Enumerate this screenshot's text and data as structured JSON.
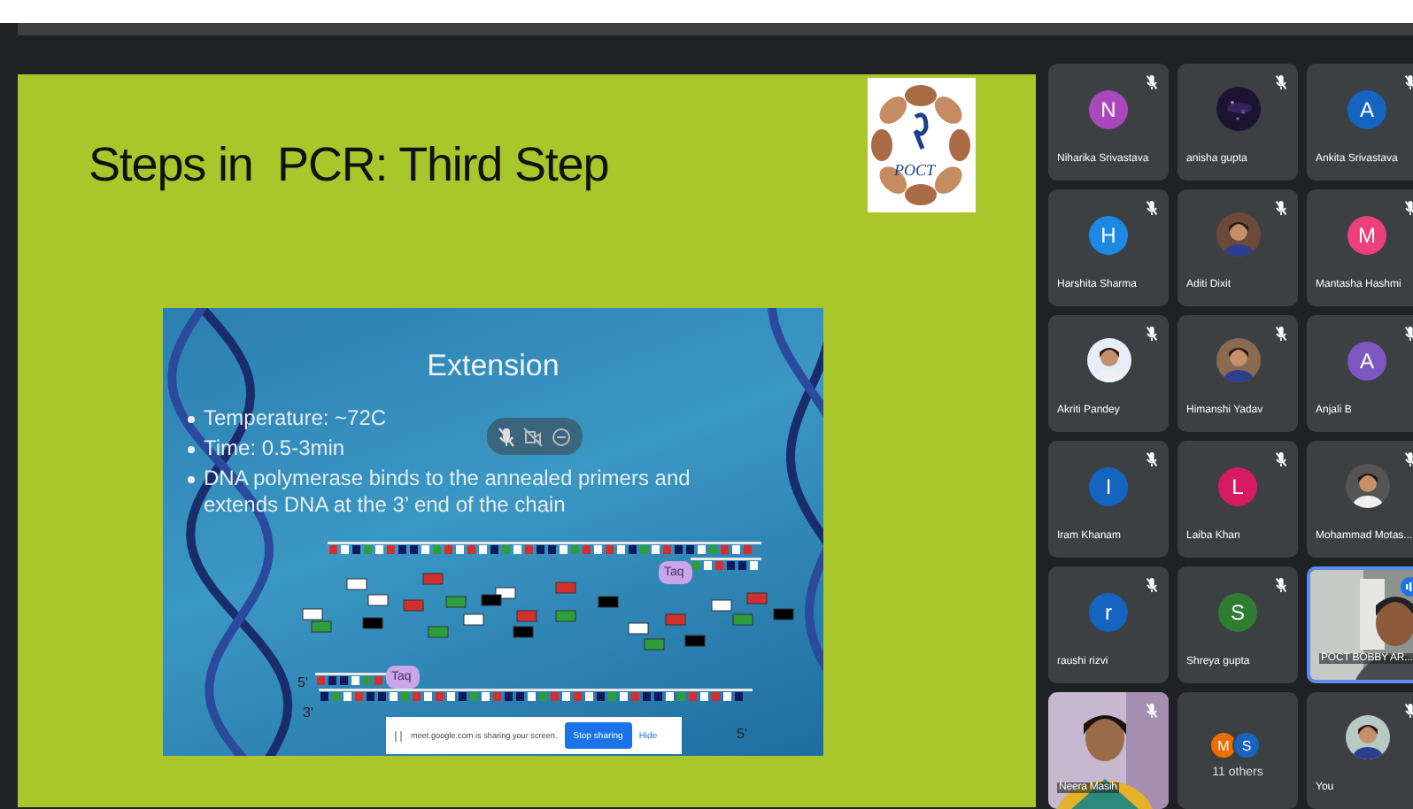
{
  "slide": {
    "title": "Steps in  PCR: Third Step",
    "logo_text": "POCT",
    "inner": {
      "title": "Extension",
      "bullets": [
        "Temperature: ~72C",
        "Time: 0.5-3min",
        "DNA polymerase binds to the annealed primers and extends DNA at the 3’ end of the chain"
      ],
      "labels": {
        "top_enzyme": "Taq",
        "bottom_enzyme": "Taq",
        "left_upper": "5'",
        "left_lower": "3'",
        "right_lower": "5'"
      }
    }
  },
  "share_bar": {
    "message": "meet.google.com is sharing your screen.",
    "stop_button": "Stop sharing",
    "hide_button": "Hide"
  },
  "participants": [
    {
      "kind": "letter",
      "name": "Niharika Srivastava",
      "letter": "N",
      "color": "#ab47bc",
      "muted": true,
      "speaking": false
    },
    {
      "kind": "picture",
      "name": "anisha gupta",
      "muted": true,
      "speaking": false
    },
    {
      "kind": "letter",
      "name": "Ankita Srivastava",
      "letter": "A",
      "color": "#1565c0",
      "muted": true,
      "speaking": false
    },
    {
      "kind": "letter",
      "name": "Harshita Sharma",
      "letter": "H",
      "color": "#1e88e5",
      "muted": true,
      "speaking": false
    },
    {
      "kind": "picture",
      "name": "Aditi Dixit",
      "muted": true,
      "speaking": false
    },
    {
      "kind": "letter",
      "name": "Mantasha Hashmi",
      "letter": "M",
      "color": "#ec407a",
      "muted": true,
      "speaking": false
    },
    {
      "kind": "picture",
      "name": "Akriti Pandey",
      "muted": true,
      "speaking": false
    },
    {
      "kind": "picture",
      "name": "Himanshi Yadav",
      "muted": true,
      "speaking": false
    },
    {
      "kind": "letter",
      "name": "Anjali B",
      "letter": "A",
      "color": "#7e57c2",
      "muted": true,
      "speaking": false
    },
    {
      "kind": "letter",
      "name": "Iram Khanam",
      "letter": "I",
      "color": "#1565c0",
      "muted": true,
      "speaking": false
    },
    {
      "kind": "letter",
      "name": "Laiba Khan",
      "letter": "L",
      "color": "#d81b60",
      "muted": true,
      "speaking": false
    },
    {
      "kind": "picture",
      "name": "Mohammad Motas...",
      "muted": true,
      "speaking": false
    },
    {
      "kind": "letter",
      "name": "raushi rizvi",
      "letter": "r",
      "color": "#1565c0",
      "muted": true,
      "speaking": false
    },
    {
      "kind": "letter",
      "name": "Shreya gupta",
      "letter": "S",
      "color": "#2e7d32",
      "muted": true,
      "speaking": false
    },
    {
      "kind": "video",
      "name": "POCT BOBBY AR...",
      "muted": false,
      "speaking": true
    },
    {
      "kind": "video",
      "name": "Neera Masih",
      "muted": true,
      "speaking": false
    },
    {
      "kind": "others",
      "name": "11 others",
      "avatars": [
        {
          "letter": "M",
          "color": "#ef6c00"
        },
        {
          "letter": "S",
          "color": "#1565c0"
        }
      ],
      "muted": false,
      "speaking": false
    },
    {
      "kind": "picture",
      "name": "You",
      "muted": true,
      "speaking": false
    }
  ]
}
